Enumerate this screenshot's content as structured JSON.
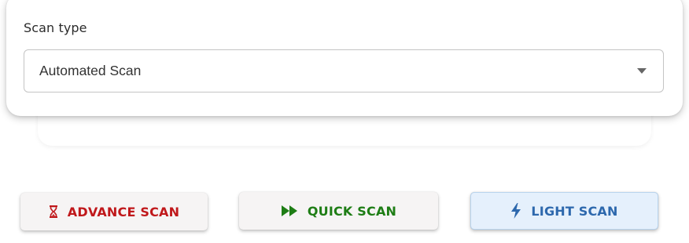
{
  "scan_type": {
    "label": "Scan type",
    "selected_value": "Automated Scan",
    "dropdown_icon": "caret-down-icon"
  },
  "buttons": {
    "advance": {
      "label": "ADVANCE SCAN",
      "icon": "hourglass-icon",
      "color": "#c0181b"
    },
    "quick": {
      "label": "QUICK SCAN",
      "icon": "fast-forward-icon",
      "color": "#1e7d15"
    },
    "light": {
      "label": "LIGHT SCAN",
      "icon": "lightning-bolt-icon",
      "color": "#2d68ad",
      "background": "#e5f0fc"
    }
  }
}
